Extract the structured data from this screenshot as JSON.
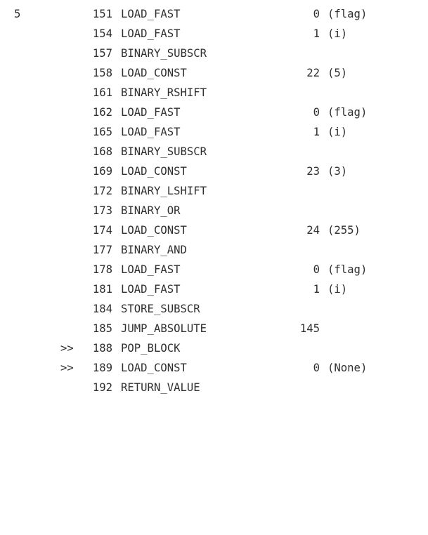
{
  "disassembly": {
    "rows": [
      {
        "line": "5",
        "marker": "",
        "offset": "151",
        "opname": "LOAD_FAST",
        "arg": "0",
        "argrepr": "(flag)"
      },
      {
        "line": "",
        "marker": "",
        "offset": "154",
        "opname": "LOAD_FAST",
        "arg": "1",
        "argrepr": "(i)"
      },
      {
        "line": "",
        "marker": "",
        "offset": "157",
        "opname": "BINARY_SUBSCR",
        "arg": "",
        "argrepr": ""
      },
      {
        "line": "",
        "marker": "",
        "offset": "158",
        "opname": "LOAD_CONST",
        "arg": "22",
        "argrepr": "(5)"
      },
      {
        "line": "",
        "marker": "",
        "offset": "161",
        "opname": "BINARY_RSHIFT",
        "arg": "",
        "argrepr": ""
      },
      {
        "line": "",
        "marker": "",
        "offset": "162",
        "opname": "LOAD_FAST",
        "arg": "0",
        "argrepr": "(flag)"
      },
      {
        "line": "",
        "marker": "",
        "offset": "165",
        "opname": "LOAD_FAST",
        "arg": "1",
        "argrepr": "(i)"
      },
      {
        "line": "",
        "marker": "",
        "offset": "168",
        "opname": "BINARY_SUBSCR",
        "arg": "",
        "argrepr": ""
      },
      {
        "line": "",
        "marker": "",
        "offset": "169",
        "opname": "LOAD_CONST",
        "arg": "23",
        "argrepr": "(3)"
      },
      {
        "line": "",
        "marker": "",
        "offset": "172",
        "opname": "BINARY_LSHIFT",
        "arg": "",
        "argrepr": ""
      },
      {
        "line": "",
        "marker": "",
        "offset": "173",
        "opname": "BINARY_OR",
        "arg": "",
        "argrepr": ""
      },
      {
        "line": "",
        "marker": "",
        "offset": "174",
        "opname": "LOAD_CONST",
        "arg": "24",
        "argrepr": "(255)"
      },
      {
        "line": "",
        "marker": "",
        "offset": "177",
        "opname": "BINARY_AND",
        "arg": "",
        "argrepr": ""
      },
      {
        "line": "",
        "marker": "",
        "offset": "178",
        "opname": "LOAD_FAST",
        "arg": "0",
        "argrepr": "(flag)"
      },
      {
        "line": "",
        "marker": "",
        "offset": "181",
        "opname": "LOAD_FAST",
        "arg": "1",
        "argrepr": "(i)"
      },
      {
        "line": "",
        "marker": "",
        "offset": "184",
        "opname": "STORE_SUBSCR",
        "arg": "",
        "argrepr": ""
      },
      {
        "line": "",
        "marker": "",
        "offset": "185",
        "opname": "JUMP_ABSOLUTE",
        "arg": "145",
        "argrepr": ""
      },
      {
        "line": "",
        "marker": ">>",
        "offset": "188",
        "opname": "POP_BLOCK",
        "arg": "",
        "argrepr": ""
      },
      {
        "line": "",
        "marker": ">>",
        "offset": "189",
        "opname": "LOAD_CONST",
        "arg": "0",
        "argrepr": "(None)"
      },
      {
        "line": "",
        "marker": "",
        "offset": "192",
        "opname": "RETURN_VALUE",
        "arg": "",
        "argrepr": ""
      }
    ]
  }
}
